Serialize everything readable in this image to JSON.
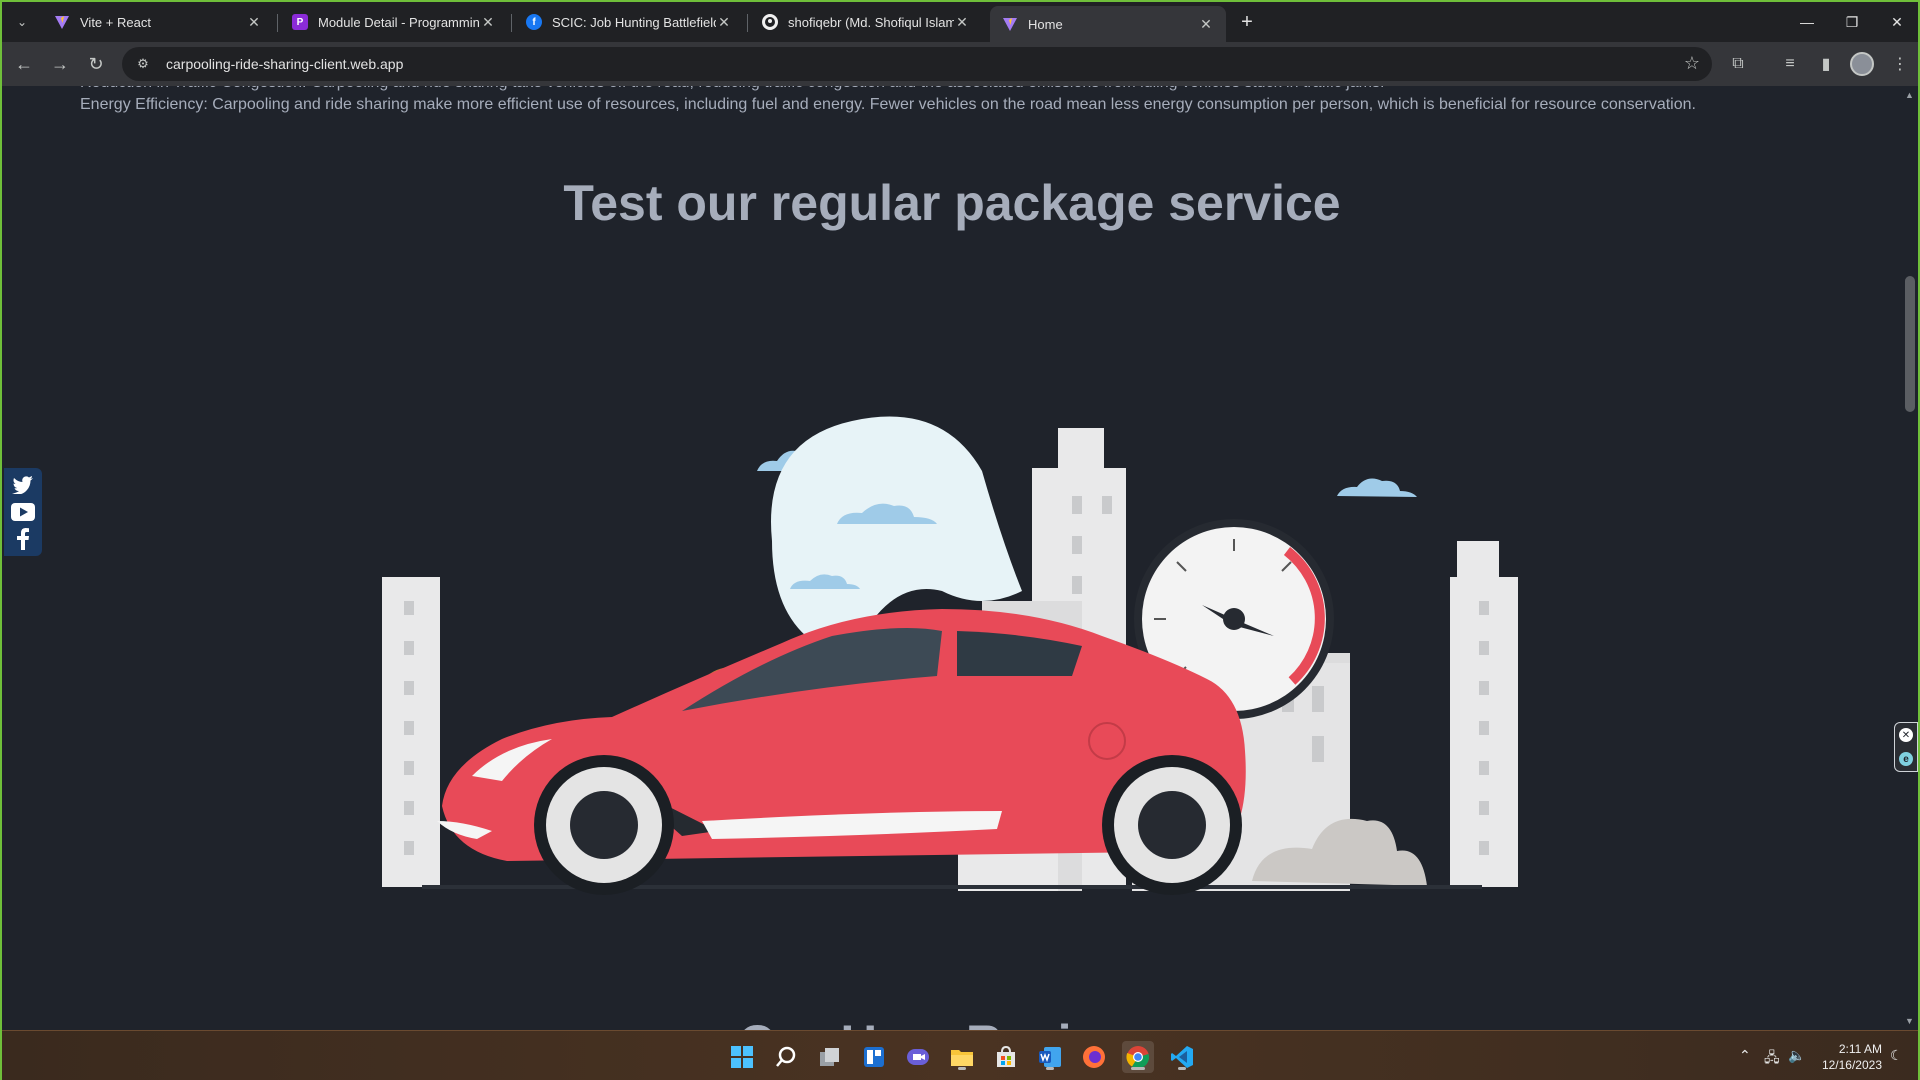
{
  "browser": {
    "tabs": [
      {
        "title": "Vite + React",
        "active": false
      },
      {
        "title": "Module Detail - Programming",
        "active": false
      },
      {
        "title": "SCIC: Job Hunting Battlefield (B",
        "active": false
      },
      {
        "title": "shofiqebr (Md. Shofiqul Islam)",
        "active": false
      },
      {
        "title": "Home",
        "active": true
      }
    ],
    "new_tab": "+",
    "url": "carpooling-ride-sharing-client.web.app"
  },
  "page": {
    "cut_paragraph": "Reduction in Traffic Congestion: Carpooling and ride sharing take vehicles off the road, reducing traffic congestion and the associated emissions from idling vehicles stuck in traffic jams.",
    "paragraph": "Energy Efficiency: Carpooling and ride sharing make more efficient use of resources, including fuel and energy. Fewer vehicles on the road mean less energy consumption per person, which is beneficial for resource conservation.",
    "heading": "Test our regular package service",
    "next_heading": "Our User Reviews"
  },
  "colors": {
    "page_bg": "#1f232b",
    "text": "#a6adbb",
    "car": "#e84a58",
    "sun": "#c07a38",
    "sky": "#e7f3f7",
    "cloud": "#9fcbe8",
    "building": "#e9e9ea"
  },
  "taskbar": {
    "time": "2:11 AM",
    "date": "12/16/2023"
  }
}
